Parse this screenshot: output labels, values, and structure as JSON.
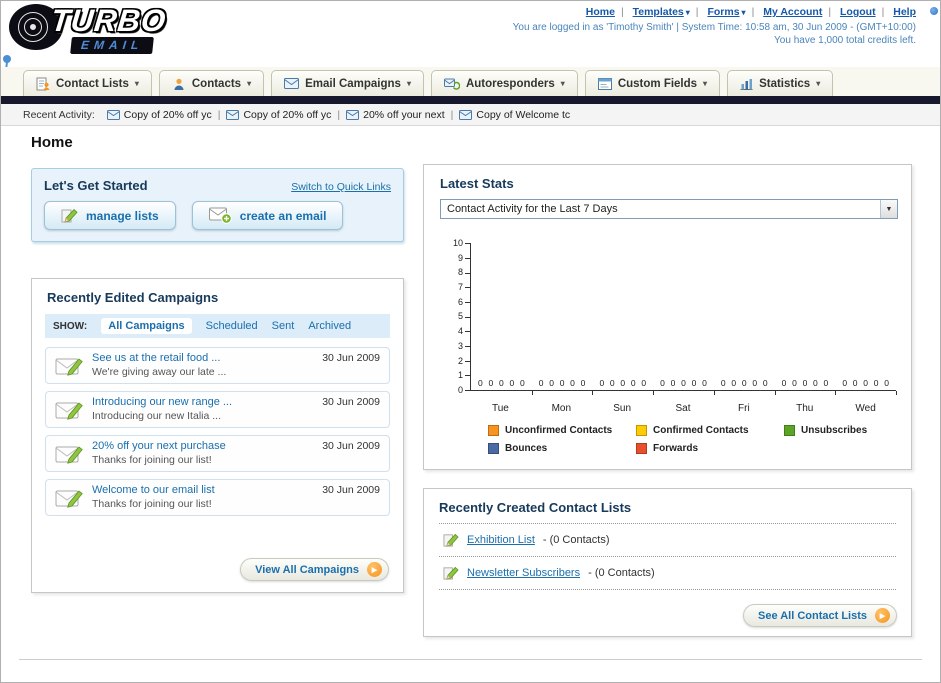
{
  "header": {
    "logo_title": "TURBO",
    "logo_subtitle": "EMAIL",
    "nav": [
      {
        "label": "Home"
      },
      {
        "label": "Templates"
      },
      {
        "label": "Forms"
      },
      {
        "label": "My Account"
      },
      {
        "label": "Logout"
      },
      {
        "label": "Help"
      }
    ],
    "login_info": "You are logged in as 'Timothy Smith' | System Time: 10:58 am, 30 Jun 2009 - (GMT+10:00)",
    "credits_info": "You have 1,000 total credits left."
  },
  "tabs": [
    {
      "label": "Contact Lists"
    },
    {
      "label": "Contacts"
    },
    {
      "label": "Email Campaigns"
    },
    {
      "label": "Autoresponders"
    },
    {
      "label": "Custom Fields"
    },
    {
      "label": "Statistics"
    }
  ],
  "recent_activity": {
    "label": "Recent Activity:",
    "items": [
      {
        "label": "Copy of 20% off yc"
      },
      {
        "label": "Copy of 20% off yc"
      },
      {
        "label": "20% off your next"
      },
      {
        "label": "Copy of Welcome tc"
      }
    ]
  },
  "page_title": "Home",
  "get_started": {
    "title": "Let's Get Started",
    "switch_link": "Switch to Quick Links",
    "manage_button": "manage lists",
    "create_button": "create an email"
  },
  "campaigns": {
    "title": "Recently Edited Campaigns",
    "show_label": "SHOW:",
    "filters": [
      "All Campaigns",
      "Scheduled",
      "Sent",
      "Archived"
    ],
    "items": [
      {
        "title": "See us at the retail food ...",
        "subtitle": "We're giving away our late ...",
        "date": "30 Jun 2009"
      },
      {
        "title": "Introducing our new range ...",
        "subtitle": "Introducing our new Italia ...",
        "date": "30 Jun 2009"
      },
      {
        "title": "20% off your next purchase",
        "subtitle": "Thanks for joining our list!",
        "date": "30 Jun 2009"
      },
      {
        "title": "Welcome to our email list",
        "subtitle": "Thanks for joining our list!",
        "date": "30 Jun 2009"
      }
    ],
    "view_all_label": "View All Campaigns"
  },
  "stats": {
    "title": "Latest Stats",
    "selected_option": "Contact Activity for the Last 7 Days",
    "chart_data": {
      "type": "bar",
      "categories": [
        "Tue",
        "Mon",
        "Sun",
        "Sat",
        "Fri",
        "Thu",
        "Wed"
      ],
      "series": [
        {
          "name": "Unconfirmed Contacts",
          "color": "#f7941d",
          "values": [
            0,
            0,
            0,
            0,
            0,
            0,
            0
          ]
        },
        {
          "name": "Confirmed Contacts",
          "color": "#ffcb05",
          "values": [
            0,
            0,
            0,
            0,
            0,
            0,
            0
          ]
        },
        {
          "name": "Unsubscribes",
          "color": "#5ba425",
          "values": [
            0,
            0,
            0,
            0,
            0,
            0,
            0
          ]
        },
        {
          "name": "Bounces",
          "color": "#4a69a5",
          "values": [
            0,
            0,
            0,
            0,
            0,
            0,
            0
          ]
        },
        {
          "name": "Forwards",
          "color": "#e8502d",
          "values": [
            0,
            0,
            0,
            0,
            0,
            0,
            0
          ]
        }
      ],
      "title": "Contact Activity for the Last 7 Days",
      "xlabel": "",
      "ylabel": "",
      "ylim": [
        0,
        10
      ],
      "grid": false,
      "legend_position": "bottom"
    }
  },
  "contact_lists": {
    "title": "Recently Created Contact Lists",
    "items": [
      {
        "name": "Exhibition List",
        "count": "- (0 Contacts)"
      },
      {
        "name": "Newsletter Subscribers",
        "count": "- (0 Contacts)"
      }
    ],
    "see_all_label": "See All Contact Lists"
  }
}
